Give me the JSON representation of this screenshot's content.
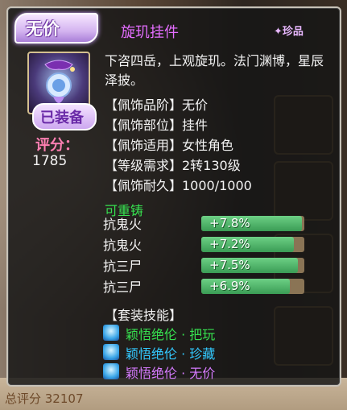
{
  "item": {
    "rarity": "无价",
    "name": "旋玑挂件",
    "badge": "珍品",
    "equipped": "已装备",
    "score_label": "评分：",
    "score": "1785",
    "description": "下咨四岳，上观旋玑。法门渊博，星辰泽披。"
  },
  "attributes": [
    {
      "text": "【佩饰品阶】无价"
    },
    {
      "text": "【佩饰部位】挂件"
    },
    {
      "text": "【佩饰适用】女性角色"
    },
    {
      "text": "【等级需求】2转130级"
    },
    {
      "text": "【佩饰耐久】1000/1000"
    }
  ],
  "recast": "可重铸",
  "stats": [
    {
      "label": "抗鬼火",
      "value": "+7.8%",
      "fill_pct": 98
    },
    {
      "label": "抗鬼火",
      "value": "+7.2%",
      "fill_pct": 90
    },
    {
      "label": "抗三尸",
      "value": "+7.5%",
      "fill_pct": 94
    },
    {
      "label": "抗三尸",
      "value": "+6.9%",
      "fill_pct": 86
    }
  ],
  "set_title": "【套装技能】",
  "set_skills": [
    {
      "name": "颖悟绝伦 · 把玩",
      "color": "#36e04f"
    },
    {
      "name": "颖悟绝伦 · 珍藏",
      "color": "#33c9ff"
    },
    {
      "name": "颖悟绝伦 · 无价",
      "color": "#d67bff"
    }
  ],
  "background": {
    "bottom_text": "总评分  32107"
  },
  "colors": {
    "name": "#e46dff",
    "recast": "#36e04f",
    "score_label": "#ff7fb2",
    "bar_fill": "#4fb866",
    "bar_track": "#8a7455"
  }
}
